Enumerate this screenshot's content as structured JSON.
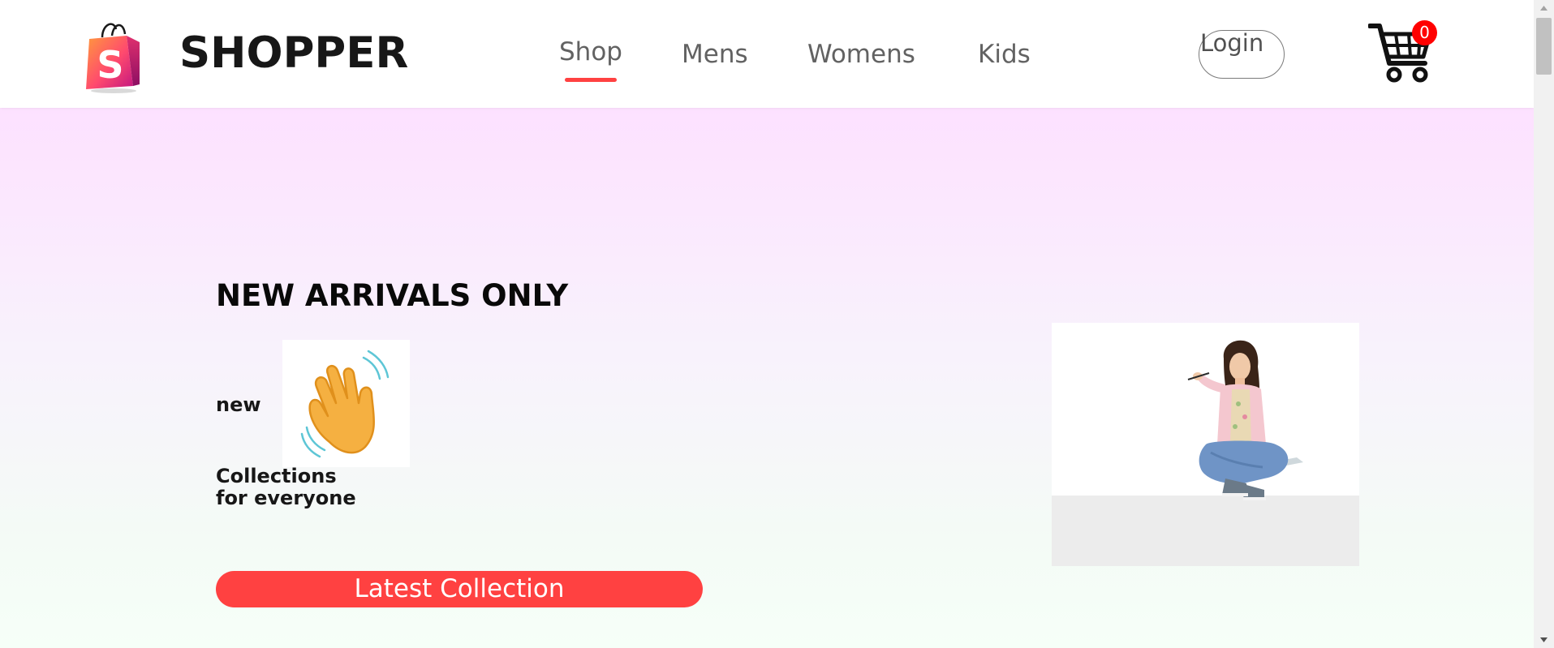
{
  "navbar": {
    "brand": "SHOPPER",
    "menu": [
      {
        "label": "Shop",
        "active": true
      },
      {
        "label": "Mens",
        "active": false
      },
      {
        "label": "Womens",
        "active": false
      },
      {
        "label": "Kids",
        "active": false
      }
    ],
    "login_label": "Login",
    "cart_count": "0",
    "icons": {
      "logo": "shopping-bag-logo-icon",
      "cart": "cart-icon"
    }
  },
  "hero": {
    "heading": "NEW ARRIVALS ONLY",
    "new_label": "new",
    "collections_line1": "Collections",
    "collections_line2": "for everyone",
    "cta_label": "Latest Collection",
    "icons": {
      "hand": "waving-hand-icon"
    }
  },
  "colors": {
    "accent": "#ff4141",
    "badge": "#ff0000",
    "hero_top": "#fde1ff",
    "hero_bottom": "#f6fff8",
    "text_dark": "#171717",
    "nav_text": "#626262"
  }
}
